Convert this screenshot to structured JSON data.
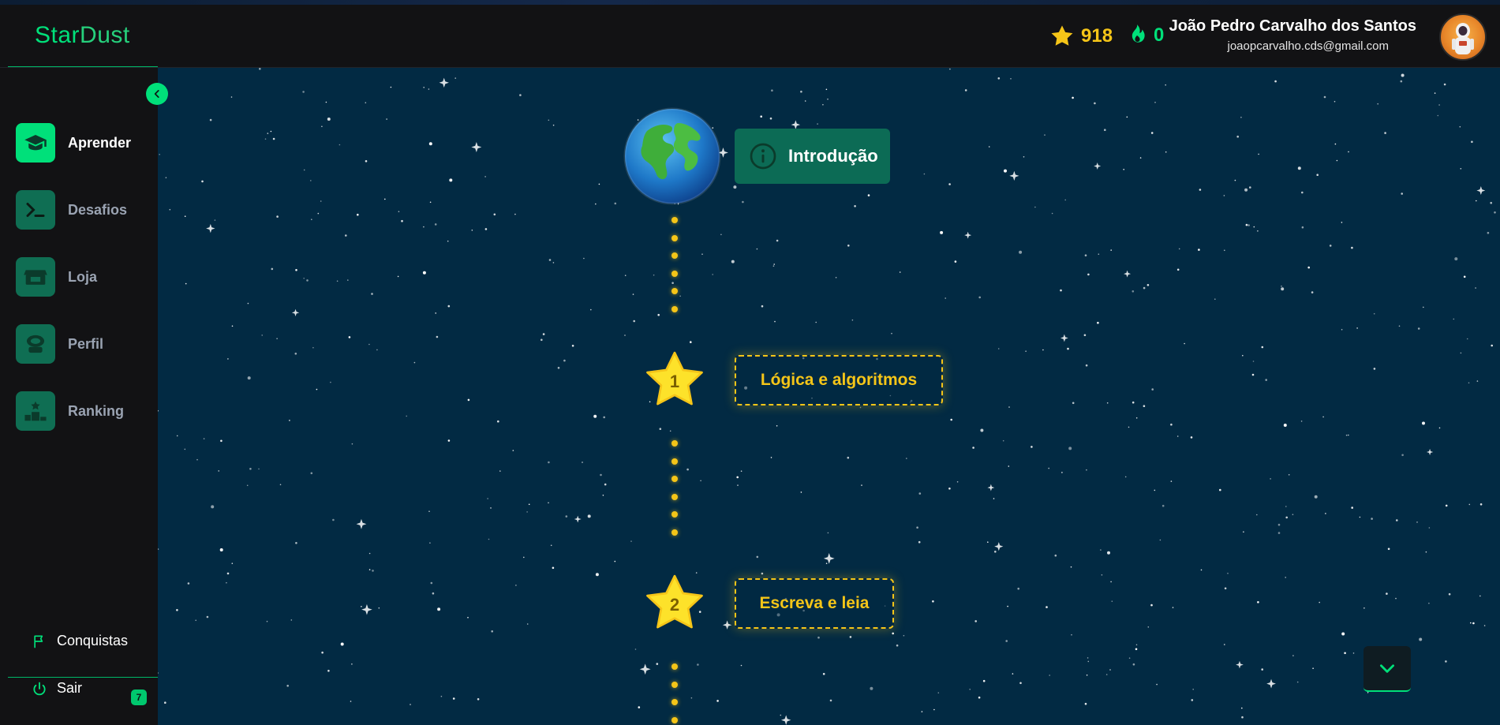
{
  "header": {
    "logo_part1": "Star",
    "logo_part2": "Dust",
    "stars_count": "918",
    "streak_count": "0",
    "user_name": "João Pedro Carvalho dos Santos",
    "user_email": "joaopcarvalho.cds@gmail.com"
  },
  "sidebar": {
    "items": [
      {
        "label": "Aprender",
        "icon": "graduation-cap-icon",
        "active": true
      },
      {
        "label": "Desafios",
        "icon": "terminal-icon",
        "active": false
      },
      {
        "label": "Loja",
        "icon": "store-icon",
        "active": false
      },
      {
        "label": "Perfil",
        "icon": "astronaut-helmet-icon",
        "active": false
      },
      {
        "label": "Ranking",
        "icon": "podium-icon",
        "active": false
      }
    ],
    "bottom": {
      "achievements_label": "Conquistas",
      "achievements_badge": "7",
      "logout_label": "Sair"
    }
  },
  "path": {
    "intro_label": "Introdução",
    "lessons": [
      {
        "number": "1",
        "title": "Lógica e algoritmos"
      },
      {
        "number": "2",
        "title": "Escreva e leia"
      }
    ]
  },
  "colors": {
    "accent": "#00e07a",
    "star_gold": "#f5c518",
    "space_bg": "#022a43",
    "sidebar_bg": "#121214",
    "nav_icon_bg": "#0f6e53"
  }
}
